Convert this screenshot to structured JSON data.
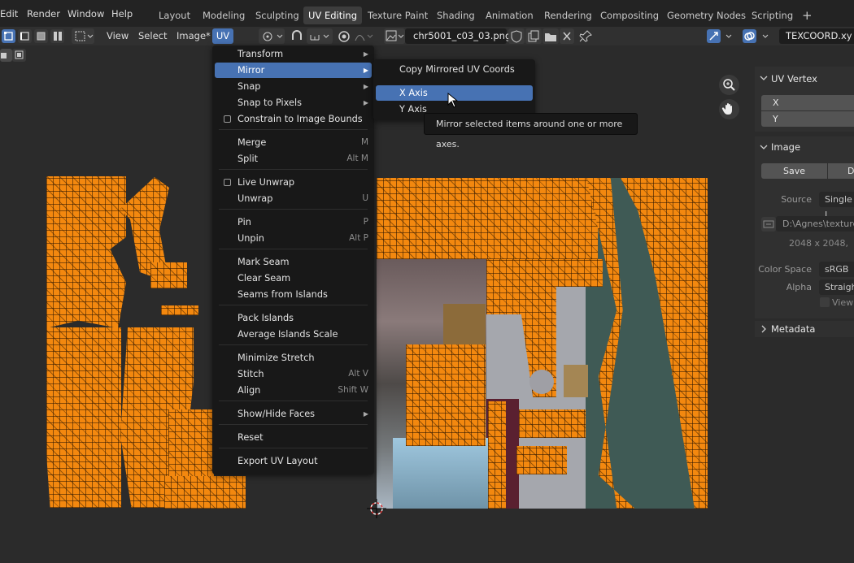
{
  "topbar": {
    "menus": [
      "Edit",
      "Render",
      "Window",
      "Help"
    ],
    "workspaces": [
      "Layout",
      "Modeling",
      "Sculpting",
      "UV Editing",
      "Texture Paint",
      "Shading",
      "Animation",
      "Rendering",
      "Compositing",
      "Geometry Nodes",
      "Scripting"
    ],
    "active_workspace": "UV Editing",
    "add_workspace": "+"
  },
  "header": {
    "menus": [
      "View",
      "Select",
      "Image*"
    ],
    "uv_menu": "UV",
    "image_name": "chr5001_c03_03.png",
    "uv_map": "TEXCOORD.xy"
  },
  "uv_menu": {
    "items": [
      {
        "label": "Transform",
        "submenu": true
      },
      {
        "label": "Mirror",
        "submenu": true,
        "highlighted": true
      },
      {
        "label": "Snap",
        "submenu": true
      },
      {
        "label": "Snap to Pixels",
        "submenu": true
      },
      {
        "label": "Constrain to Image Bounds",
        "checkbox": true
      },
      {
        "label": "Merge",
        "shortcut": "M"
      },
      {
        "label": "Split",
        "shortcut": "Alt M"
      },
      {
        "label": "Live Unwrap",
        "checkbox": true
      },
      {
        "label": "Unwrap",
        "shortcut": "U"
      },
      {
        "label": "Pin",
        "shortcut": "P"
      },
      {
        "label": "Unpin",
        "shortcut": "Alt P"
      },
      {
        "label": "Mark Seam"
      },
      {
        "label": "Clear Seam"
      },
      {
        "label": "Seams from Islands"
      },
      {
        "label": "Pack Islands"
      },
      {
        "label": "Average Islands Scale"
      },
      {
        "label": "Minimize Stretch"
      },
      {
        "label": "Stitch",
        "shortcut": "Alt V"
      },
      {
        "label": "Align",
        "shortcut": "Shift W"
      },
      {
        "label": "Show/Hide Faces",
        "submenu": true
      },
      {
        "label": "Reset"
      },
      {
        "label": "Export UV Layout"
      }
    ]
  },
  "mirror_submenu": {
    "items": [
      "Copy Mirrored UV Coords",
      "X Axis",
      "Y Axis"
    ],
    "highlighted": "X Axis"
  },
  "tooltip": "Mirror selected items around one or more axes.",
  "npanel": {
    "uv_vertex": {
      "title": "UV Vertex",
      "x_label": "X",
      "y_label": "Y"
    },
    "image": {
      "title": "Image",
      "save": "Save",
      "discard": "D",
      "source_label": "Source",
      "source_value": "Single I",
      "filepath": "D:\\Agnes\\textures",
      "resolution": "2048 x 2048,",
      "color_space_label": "Color Space",
      "color_space_value": "sRGB",
      "alpha_label": "Alpha",
      "alpha_value": "Straigh",
      "view_label": "View"
    },
    "metadata": {
      "title": "Metadata"
    }
  },
  "colors": {
    "accent": "#4772b3",
    "uv_mesh": "#f3880f",
    "menu_bg": "#181818"
  }
}
